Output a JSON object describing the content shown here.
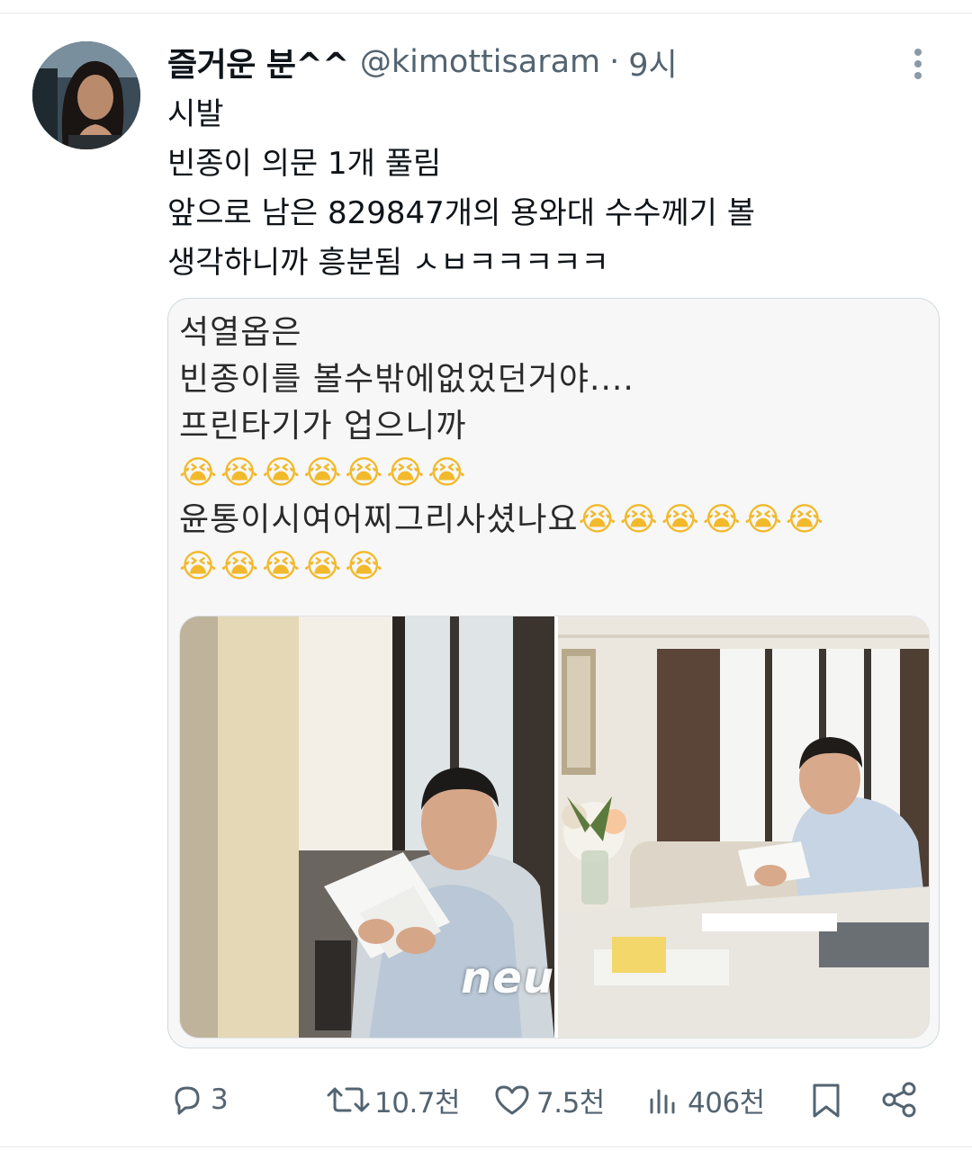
{
  "tweet": {
    "display_name": "즐거운 분^^",
    "handle": "@kimottisaram",
    "separator": "·",
    "time": "9시",
    "lines": [
      "시발",
      "빈종이 의문 1개 풀림",
      "앞으로 남은 829847개의 용와대 수수께기 볼",
      "생각하니까 흥분됨 ㅅㅂㅋㅋㅋㅋㅋ"
    ]
  },
  "quote": {
    "line1": "석열옵은",
    "line2": "빈종이를 볼수밖에없었던거야....",
    "line3": "프린타기가 업으니까",
    "emoji_row1": "😭😭😭😭😭😭😭",
    "line5_text": "윤통이시여어찌그리사셨나요",
    "emoji_row2": "😭😭😭😭😭😭",
    "emoji_row3": "😭😭😭😭😭",
    "watermark": "neu"
  },
  "actions": {
    "reply": {
      "icon": "reply-icon",
      "count": "3"
    },
    "retweet": {
      "icon": "retweet-icon",
      "count": "10.7천"
    },
    "like": {
      "icon": "heart-icon",
      "count": "7.5천"
    },
    "views": {
      "icon": "views-icon",
      "count": "406천"
    },
    "bookmark": {
      "icon": "bookmark-icon"
    },
    "share": {
      "icon": "share-icon"
    }
  },
  "colors": {
    "text_primary": "#0f1419",
    "text_secondary": "#536471",
    "border": "#cfd9de",
    "card_bg": "#f7f7f8"
  }
}
